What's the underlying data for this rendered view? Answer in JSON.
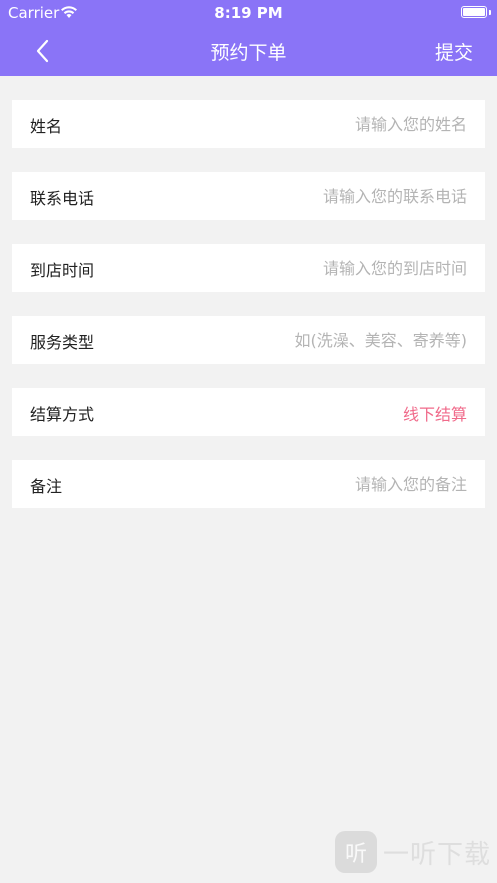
{
  "status_bar": {
    "carrier": "Carrier",
    "time": "8:19 PM"
  },
  "header": {
    "title": "预约下单",
    "submit_label": "提交"
  },
  "form": {
    "name": {
      "label": "姓名",
      "placeholder": "请输入您的姓名",
      "value": ""
    },
    "phone": {
      "label": "联系电话",
      "placeholder": "请输入您的联系电话",
      "value": ""
    },
    "arrival_time": {
      "label": "到店时间",
      "placeholder": "请输入您的到店时间",
      "value": ""
    },
    "service_type": {
      "label": "服务类型",
      "placeholder": "如(洗澡、美容、寄养等)",
      "value": ""
    },
    "payment": {
      "label": "结算方式",
      "value": "线下结算"
    },
    "remark": {
      "label": "备注",
      "placeholder": "请输入您的备注",
      "value": ""
    }
  },
  "colors": {
    "header_bg": "#8a74f7",
    "page_bg": "#f2f2f2",
    "accent": "#f06a8a"
  },
  "watermark": {
    "logo_glyph": "听",
    "text": "一听下载"
  }
}
